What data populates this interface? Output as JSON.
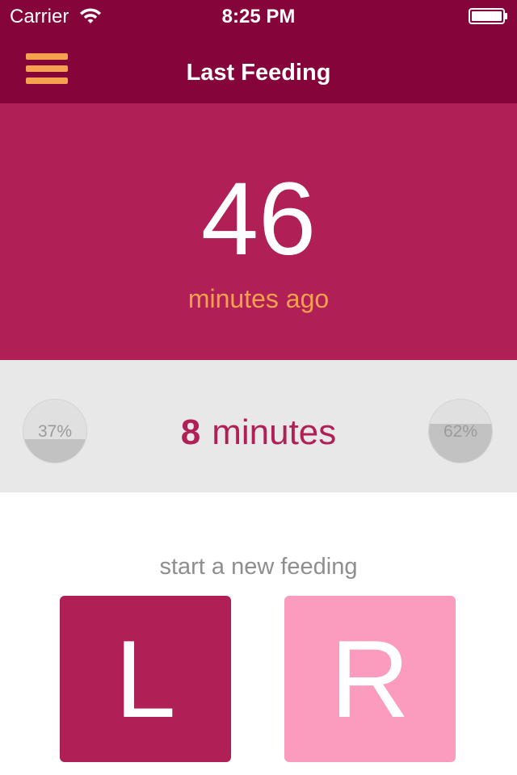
{
  "status_bar": {
    "carrier": "Carrier",
    "time": "8:25 PM",
    "wifi_icon": "wifi-icon",
    "battery_icon": "battery-icon"
  },
  "nav": {
    "title": "Last Feeding",
    "menu_icon": "hamburger-menu-icon"
  },
  "last_feeding": {
    "elapsed_value": "46",
    "elapsed_unit": "minutes ago"
  },
  "duration": {
    "value": "8",
    "unit": "minutes",
    "left_side": {
      "percent_label": "37%",
      "fraction": 0.37
    },
    "right_side": {
      "percent_label": "62%",
      "fraction": 0.62
    }
  },
  "new_feeding": {
    "prompt": "start a new feeding",
    "left_label": "L",
    "right_label": "R"
  },
  "colors": {
    "nav_background": "#850439",
    "hero_background": "#b01f55",
    "accent_orange": "#f6a14d",
    "left_button": "#b01f55",
    "right_button": "#fb9cbf",
    "band_background": "#e8e8e8"
  }
}
